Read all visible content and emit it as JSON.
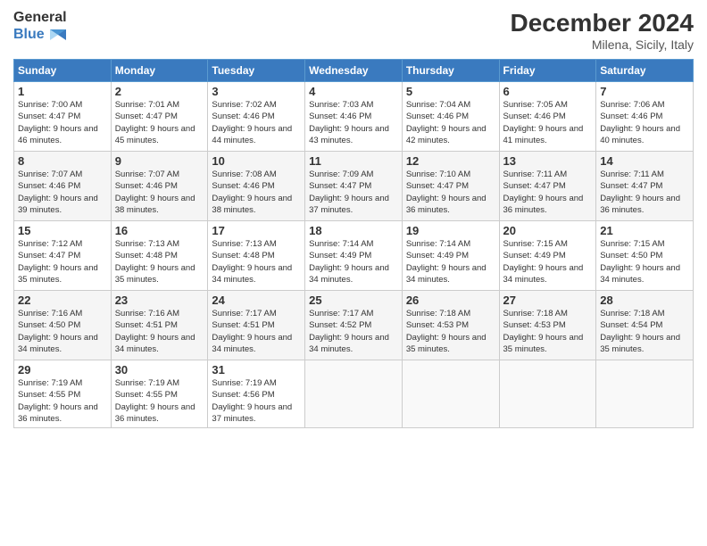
{
  "header": {
    "logo_line1": "General",
    "logo_line2": "Blue",
    "month": "December 2024",
    "location": "Milena, Sicily, Italy"
  },
  "days_of_week": [
    "Sunday",
    "Monday",
    "Tuesday",
    "Wednesday",
    "Thursday",
    "Friday",
    "Saturday"
  ],
  "weeks": [
    [
      {
        "day": 1,
        "sunrise": "7:00 AM",
        "sunset": "4:47 PM",
        "daylight": "9 hours and 46 minutes."
      },
      {
        "day": 2,
        "sunrise": "7:01 AM",
        "sunset": "4:47 PM",
        "daylight": "9 hours and 45 minutes."
      },
      {
        "day": 3,
        "sunrise": "7:02 AM",
        "sunset": "4:46 PM",
        "daylight": "9 hours and 44 minutes."
      },
      {
        "day": 4,
        "sunrise": "7:03 AM",
        "sunset": "4:46 PM",
        "daylight": "9 hours and 43 minutes."
      },
      {
        "day": 5,
        "sunrise": "7:04 AM",
        "sunset": "4:46 PM",
        "daylight": "9 hours and 42 minutes."
      },
      {
        "day": 6,
        "sunrise": "7:05 AM",
        "sunset": "4:46 PM",
        "daylight": "9 hours and 41 minutes."
      },
      {
        "day": 7,
        "sunrise": "7:06 AM",
        "sunset": "4:46 PM",
        "daylight": "9 hours and 40 minutes."
      }
    ],
    [
      {
        "day": 8,
        "sunrise": "7:07 AM",
        "sunset": "4:46 PM",
        "daylight": "9 hours and 39 minutes."
      },
      {
        "day": 9,
        "sunrise": "7:07 AM",
        "sunset": "4:46 PM",
        "daylight": "9 hours and 38 minutes."
      },
      {
        "day": 10,
        "sunrise": "7:08 AM",
        "sunset": "4:46 PM",
        "daylight": "9 hours and 38 minutes."
      },
      {
        "day": 11,
        "sunrise": "7:09 AM",
        "sunset": "4:47 PM",
        "daylight": "9 hours and 37 minutes."
      },
      {
        "day": 12,
        "sunrise": "7:10 AM",
        "sunset": "4:47 PM",
        "daylight": "9 hours and 36 minutes."
      },
      {
        "day": 13,
        "sunrise": "7:11 AM",
        "sunset": "4:47 PM",
        "daylight": "9 hours and 36 minutes."
      },
      {
        "day": 14,
        "sunrise": "7:11 AM",
        "sunset": "4:47 PM",
        "daylight": "9 hours and 36 minutes."
      }
    ],
    [
      {
        "day": 15,
        "sunrise": "7:12 AM",
        "sunset": "4:47 PM",
        "daylight": "9 hours and 35 minutes."
      },
      {
        "day": 16,
        "sunrise": "7:13 AM",
        "sunset": "4:48 PM",
        "daylight": "9 hours and 35 minutes."
      },
      {
        "day": 17,
        "sunrise": "7:13 AM",
        "sunset": "4:48 PM",
        "daylight": "9 hours and 34 minutes."
      },
      {
        "day": 18,
        "sunrise": "7:14 AM",
        "sunset": "4:49 PM",
        "daylight": "9 hours and 34 minutes."
      },
      {
        "day": 19,
        "sunrise": "7:14 AM",
        "sunset": "4:49 PM",
        "daylight": "9 hours and 34 minutes."
      },
      {
        "day": 20,
        "sunrise": "7:15 AM",
        "sunset": "4:49 PM",
        "daylight": "9 hours and 34 minutes."
      },
      {
        "day": 21,
        "sunrise": "7:15 AM",
        "sunset": "4:50 PM",
        "daylight": "9 hours and 34 minutes."
      }
    ],
    [
      {
        "day": 22,
        "sunrise": "7:16 AM",
        "sunset": "4:50 PM",
        "daylight": "9 hours and 34 minutes."
      },
      {
        "day": 23,
        "sunrise": "7:16 AM",
        "sunset": "4:51 PM",
        "daylight": "9 hours and 34 minutes."
      },
      {
        "day": 24,
        "sunrise": "7:17 AM",
        "sunset": "4:51 PM",
        "daylight": "9 hours and 34 minutes."
      },
      {
        "day": 25,
        "sunrise": "7:17 AM",
        "sunset": "4:52 PM",
        "daylight": "9 hours and 34 minutes."
      },
      {
        "day": 26,
        "sunrise": "7:18 AM",
        "sunset": "4:53 PM",
        "daylight": "9 hours and 35 minutes."
      },
      {
        "day": 27,
        "sunrise": "7:18 AM",
        "sunset": "4:53 PM",
        "daylight": "9 hours and 35 minutes."
      },
      {
        "day": 28,
        "sunrise": "7:18 AM",
        "sunset": "4:54 PM",
        "daylight": "9 hours and 35 minutes."
      }
    ],
    [
      {
        "day": 29,
        "sunrise": "7:19 AM",
        "sunset": "4:55 PM",
        "daylight": "9 hours and 36 minutes."
      },
      {
        "day": 30,
        "sunrise": "7:19 AM",
        "sunset": "4:55 PM",
        "daylight": "9 hours and 36 minutes."
      },
      {
        "day": 31,
        "sunrise": "7:19 AM",
        "sunset": "4:56 PM",
        "daylight": "9 hours and 37 minutes."
      },
      null,
      null,
      null,
      null
    ]
  ]
}
